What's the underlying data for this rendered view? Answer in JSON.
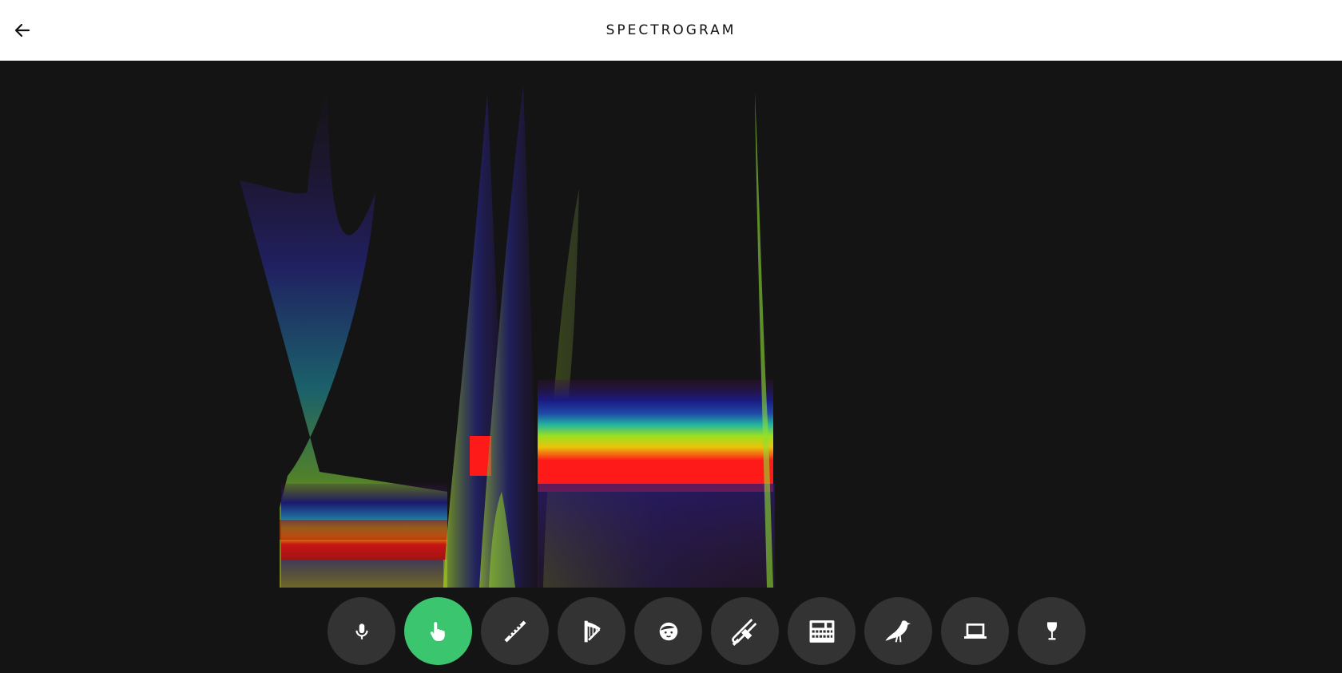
{
  "header": {
    "title": "SPECTROGRAM",
    "back_icon": "arrow-left-icon"
  },
  "colors": {
    "header_bg": "#ffffff",
    "canvas_bg": "#141414",
    "button_bg": "#333333",
    "active_button_bg": "#3cc56f"
  },
  "toolbar": {
    "active": "touch",
    "buttons": [
      {
        "id": "microphone",
        "icon": "microphone-icon"
      },
      {
        "id": "touch",
        "icon": "pointing-hand-icon"
      },
      {
        "id": "flute",
        "icon": "flute-icon"
      },
      {
        "id": "harp",
        "icon": "harp-icon"
      },
      {
        "id": "face",
        "icon": "face-icon"
      },
      {
        "id": "trombone",
        "icon": "trombone-icon"
      },
      {
        "id": "drum-machine",
        "icon": "drum-machine-icon"
      },
      {
        "id": "bird",
        "icon": "bird-icon"
      },
      {
        "id": "laptop",
        "icon": "laptop-icon"
      },
      {
        "id": "wine-glass",
        "icon": "wine-glass-icon"
      }
    ]
  }
}
